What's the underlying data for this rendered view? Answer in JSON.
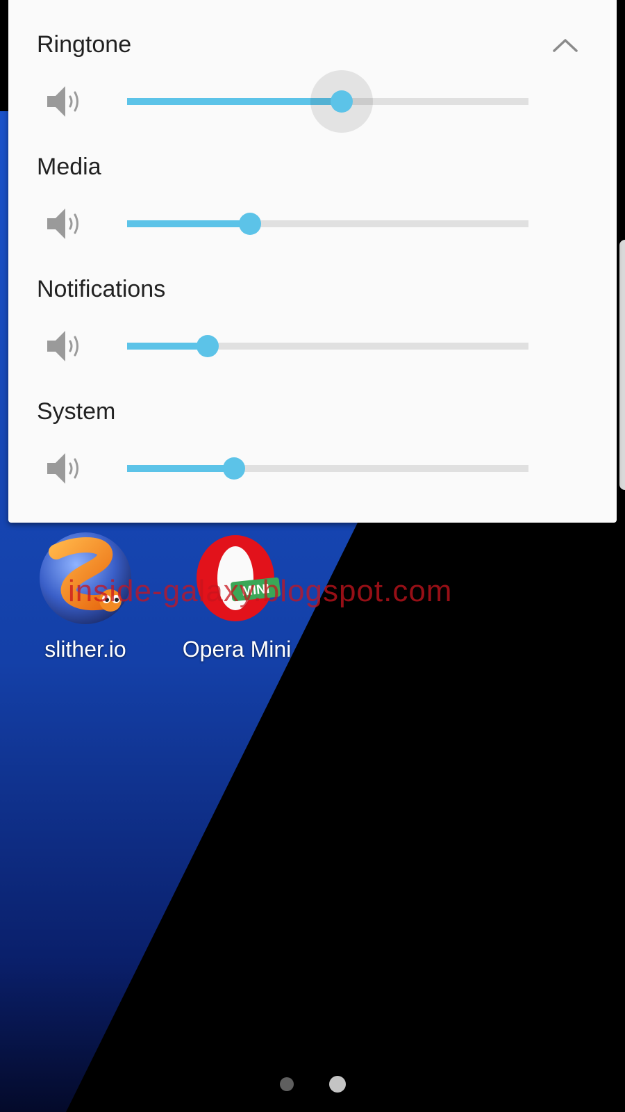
{
  "volume_panel": {
    "rows": [
      {
        "label": "Ringtone",
        "level": 0.535,
        "active": true
      },
      {
        "label": "Media",
        "level": 0.307,
        "active": false
      },
      {
        "label": "Notifications",
        "level": 0.2,
        "active": false
      },
      {
        "label": "System",
        "level": 0.266,
        "active": false
      }
    ],
    "collapse_icon": "chevron-up-icon",
    "row_icon": "speaker-icon"
  },
  "home_screen": {
    "apps": [
      {
        "label": "slither.io",
        "icon": "slither-io-icon"
      },
      {
        "label": "Opera Mini",
        "icon": "opera-mini-icon",
        "badge": "MINI"
      }
    ],
    "watermark": "inside-galaxy.blogspot.com",
    "page_count": 2,
    "current_page": 2
  },
  "colors": {
    "accent": "#5cc3e8",
    "track": "#e0e0e0",
    "panel": "#fafafa",
    "wallpaper_blue": "#1748b8",
    "opera_red": "#e2121b",
    "mini_green": "#3aa757"
  }
}
